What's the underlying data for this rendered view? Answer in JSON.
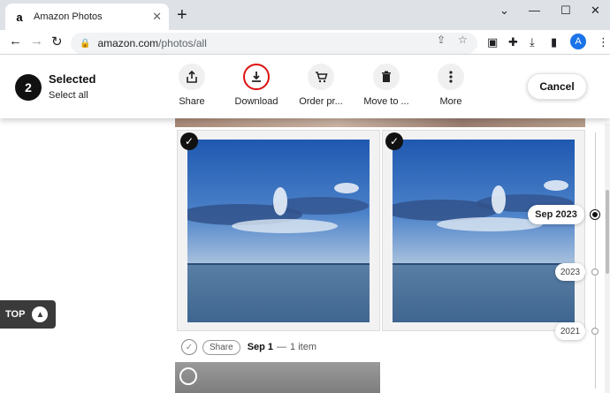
{
  "browser": {
    "tab_title": "Amazon Photos",
    "tab_favicon": "a",
    "new_tab": "+",
    "url_host": "amazon.com",
    "url_path": "/photos/all",
    "profile_initial": "A"
  },
  "selection_bar": {
    "count": "2",
    "title": "Selected",
    "select_all": "Select all",
    "actions": [
      {
        "label": "Share",
        "icon": "share-icon"
      },
      {
        "label": "Download",
        "icon": "download-icon"
      },
      {
        "label": "Order pr...",
        "icon": "cart-icon"
      },
      {
        "label": "Move to ...",
        "icon": "trash-icon"
      },
      {
        "label": "More",
        "icon": "more-icon"
      }
    ],
    "cancel": "Cancel"
  },
  "photo_group": {
    "share": "Share",
    "date": "Sep 1",
    "separator": "—",
    "count": "1 item"
  },
  "timeline": {
    "current": "Sep 2023",
    "years": [
      "2023",
      "2021"
    ]
  },
  "top_button": "TOP",
  "colors": {
    "highlight": "#d11111",
    "sky": "#2f63b0",
    "sea": "#4b6f95"
  }
}
